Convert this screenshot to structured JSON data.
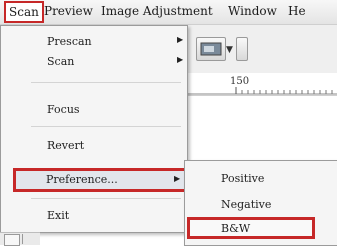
{
  "menubar": {
    "items": [
      "Scan",
      "Preview",
      "Image Adjustment",
      "Window",
      "He"
    ]
  },
  "ruler": {
    "label": "150"
  },
  "menu": {
    "items": [
      {
        "label": "Prescan",
        "arrow": "▶"
      },
      {
        "label": "Scan",
        "arrow": "▶"
      },
      {
        "label": "Focus"
      },
      {
        "label": "Revert"
      },
      {
        "label": "Preference...",
        "arrow": "▶",
        "highlighted": true
      },
      {
        "label": "Exit"
      }
    ]
  },
  "submenu": {
    "items": [
      {
        "label": "Positive"
      },
      {
        "label": "Negative"
      },
      {
        "label": "B&W",
        "highlighted": true
      }
    ]
  },
  "colors": {
    "highlight_border": "#c62828",
    "menu_bg": "#f5f5f5"
  },
  "icons": [
    "preview-window-icon",
    "dropdown-arrow-icon",
    "submenu-arrow-icon"
  ]
}
